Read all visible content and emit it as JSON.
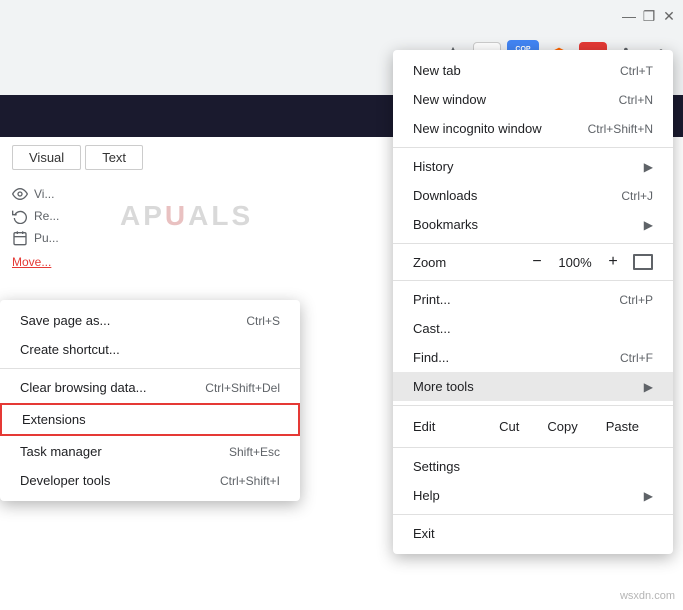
{
  "titleBar": {
    "minimize": "—",
    "maximize": "❐",
    "close": "✕"
  },
  "toolbar": {
    "star": "☆",
    "copyExt": {
      "line1": "COPY",
      "badgeTop": "COP"
    },
    "abp": "ABP",
    "puzzle": "🧩",
    "menuDots": "⋮"
  },
  "menu": {
    "items": [
      {
        "label": "New tab",
        "shortcut": "Ctrl+T",
        "arrow": ""
      },
      {
        "label": "New window",
        "shortcut": "Ctrl+N",
        "arrow": ""
      },
      {
        "label": "New incognito window",
        "shortcut": "Ctrl+Shift+N",
        "arrow": ""
      },
      {
        "label": "History",
        "shortcut": "",
        "arrow": "▶"
      },
      {
        "label": "Downloads",
        "shortcut": "Ctrl+J",
        "arrow": ""
      },
      {
        "label": "Bookmarks",
        "shortcut": "",
        "arrow": "▶"
      },
      {
        "label": "Zoom",
        "shortcut": "",
        "arrow": ""
      },
      {
        "label": "Print...",
        "shortcut": "Ctrl+P",
        "arrow": ""
      },
      {
        "label": "Cast...",
        "shortcut": "",
        "arrow": ""
      },
      {
        "label": "Find...",
        "shortcut": "Ctrl+F",
        "arrow": ""
      },
      {
        "label": "More tools",
        "shortcut": "",
        "arrow": "▶"
      },
      {
        "label": "Edit",
        "shortcut": "",
        "arrow": ""
      },
      {
        "label": "Settings",
        "shortcut": "",
        "arrow": ""
      },
      {
        "label": "Help",
        "shortcut": "",
        "arrow": "▶"
      },
      {
        "label": "Exit",
        "shortcut": "",
        "arrow": ""
      }
    ],
    "zoom": {
      "label": "Zoom",
      "minus": "−",
      "value": "100%",
      "plus": "+"
    },
    "edit": {
      "label": "Edit",
      "cut": "Cut",
      "copy": "Copy",
      "paste": "Paste"
    }
  },
  "subMenu": {
    "items": [
      {
        "label": "Save page as...",
        "shortcut": "Ctrl+S"
      },
      {
        "label": "Create shortcut...",
        "shortcut": ""
      },
      {
        "label": "Clear browsing data...",
        "shortcut": "Ctrl+Shift+Del"
      },
      {
        "label": "Extensions",
        "shortcut": ""
      },
      {
        "label": "Task manager",
        "shortcut": "Shift+Esc"
      },
      {
        "label": "Developer tools",
        "shortcut": "Ctrl+Shift+I"
      }
    ]
  },
  "page": {
    "tabs": [
      "Visual",
      "Text"
    ],
    "icons": [
      "Vi...",
      "Re...",
      "Pu..."
    ],
    "moveLink": "Move..."
  },
  "watermark": "wsxdn.com"
}
